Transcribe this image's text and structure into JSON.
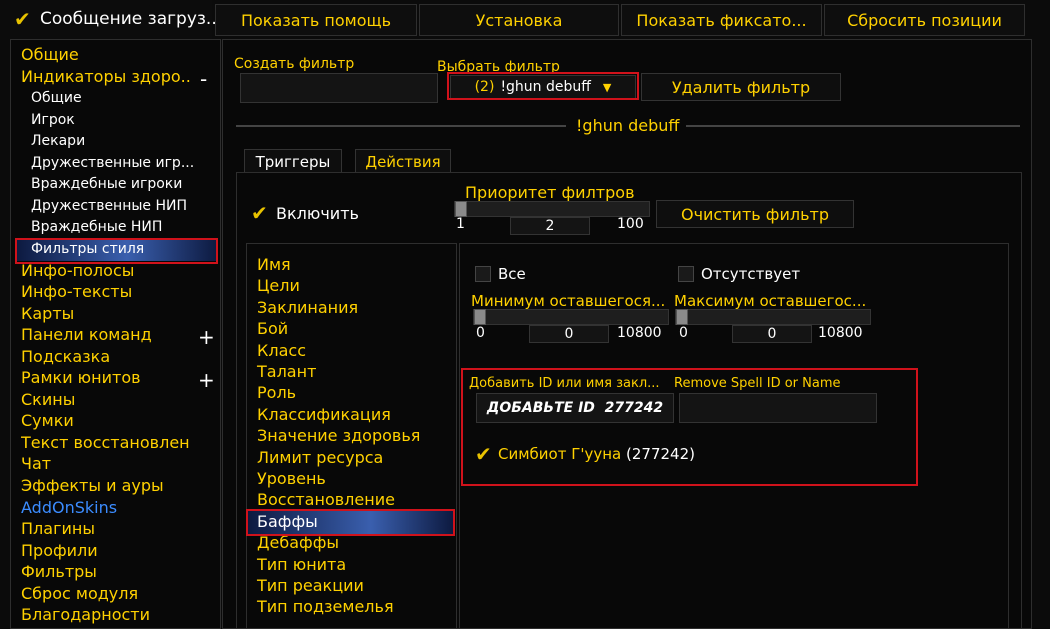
{
  "header": {
    "title": "Сообщение загруз...",
    "buttons": [
      "Показать помощь",
      "Установка",
      "Показать фиксато...",
      "Сбросить позиции"
    ]
  },
  "sidebar": {
    "items": [
      {
        "label": "Общие"
      },
      {
        "label": "Индикаторы здоро...",
        "toggle": "-"
      },
      {
        "label": "Общие",
        "sub": true
      },
      {
        "label": "Игрок",
        "sub": true
      },
      {
        "label": "Лекари",
        "sub": true
      },
      {
        "label": "Дружественные игр...",
        "sub": true
      },
      {
        "label": "Враждебные игроки",
        "sub": true
      },
      {
        "label": "Дружественные НИП",
        "sub": true
      },
      {
        "label": "Враждебные НИП",
        "sub": true
      },
      {
        "label": "Фильтры стиля",
        "sub": true,
        "selected": true
      },
      {
        "label": "Инфо-полосы"
      },
      {
        "label": "Инфо-тексты"
      },
      {
        "label": "Карты"
      },
      {
        "label": "Панели команд",
        "toggle": "+"
      },
      {
        "label": "Подсказка"
      },
      {
        "label": "Рамки юнитов",
        "toggle": "+"
      },
      {
        "label": "Скины"
      },
      {
        "label": "Сумки"
      },
      {
        "label": "Текст восстановлен..."
      },
      {
        "label": "Чат"
      },
      {
        "label": "Эффекты и ауры"
      },
      {
        "label": "AddOnSkins",
        "color": "#3b8cff"
      },
      {
        "label": "Плагины"
      },
      {
        "label": "Профили"
      },
      {
        "label": "Фильтры"
      },
      {
        "label": "Сброс модуля"
      },
      {
        "label": "Благодарности"
      }
    ]
  },
  "filter": {
    "create_label": "Создать фильтр",
    "create_value": "",
    "select_label": "Выбрать фильтр",
    "select_value_prefix": "(2)",
    "select_value_name": "!ghun debuff",
    "delete_label": "Удалить фильтр",
    "section_title": "!ghun debuff"
  },
  "tabs": [
    "Триггеры",
    "Действия"
  ],
  "controls": {
    "enable_label": "Включить",
    "priority_label": "Приоритет филтров",
    "priority_min": "1",
    "priority_value": "2",
    "priority_max": "100",
    "clear_label": "Очистить фильтр"
  },
  "trigger_list": [
    "Имя",
    "Цели",
    "Заклинания",
    "Бой",
    "Класс",
    "Талант",
    "Роль",
    "Классификация",
    "Значение здоровья",
    "Лимит ресурса",
    "Уровень",
    "Восстановление",
    "Баффы",
    "Дебаффы",
    "Тип юнита",
    "Тип реакции",
    "Тип подземелья"
  ],
  "trigger_selected": 12,
  "buffs": {
    "all_label": "Все",
    "missing_label": "Отсутствует",
    "min_label": "Минимум оставшегося...",
    "max_label": "Максимум оставшегос...",
    "min_low": "0",
    "min_value": "0",
    "min_high": "10800",
    "max_low": "0",
    "max_value": "0",
    "max_high": "10800",
    "add_label": "Добавить ID или имя закл...",
    "add_value": "ДОБАВЬТЕ ID  277242",
    "remove_label": "Remove Spell ID or Name",
    "remove_value": "",
    "spell_name": "Симбиот Г'ууна",
    "spell_id": "(277242)"
  },
  "colors": {
    "accent": "#ffd100",
    "highlight": "#d0121b",
    "link": "#3b8cff"
  }
}
